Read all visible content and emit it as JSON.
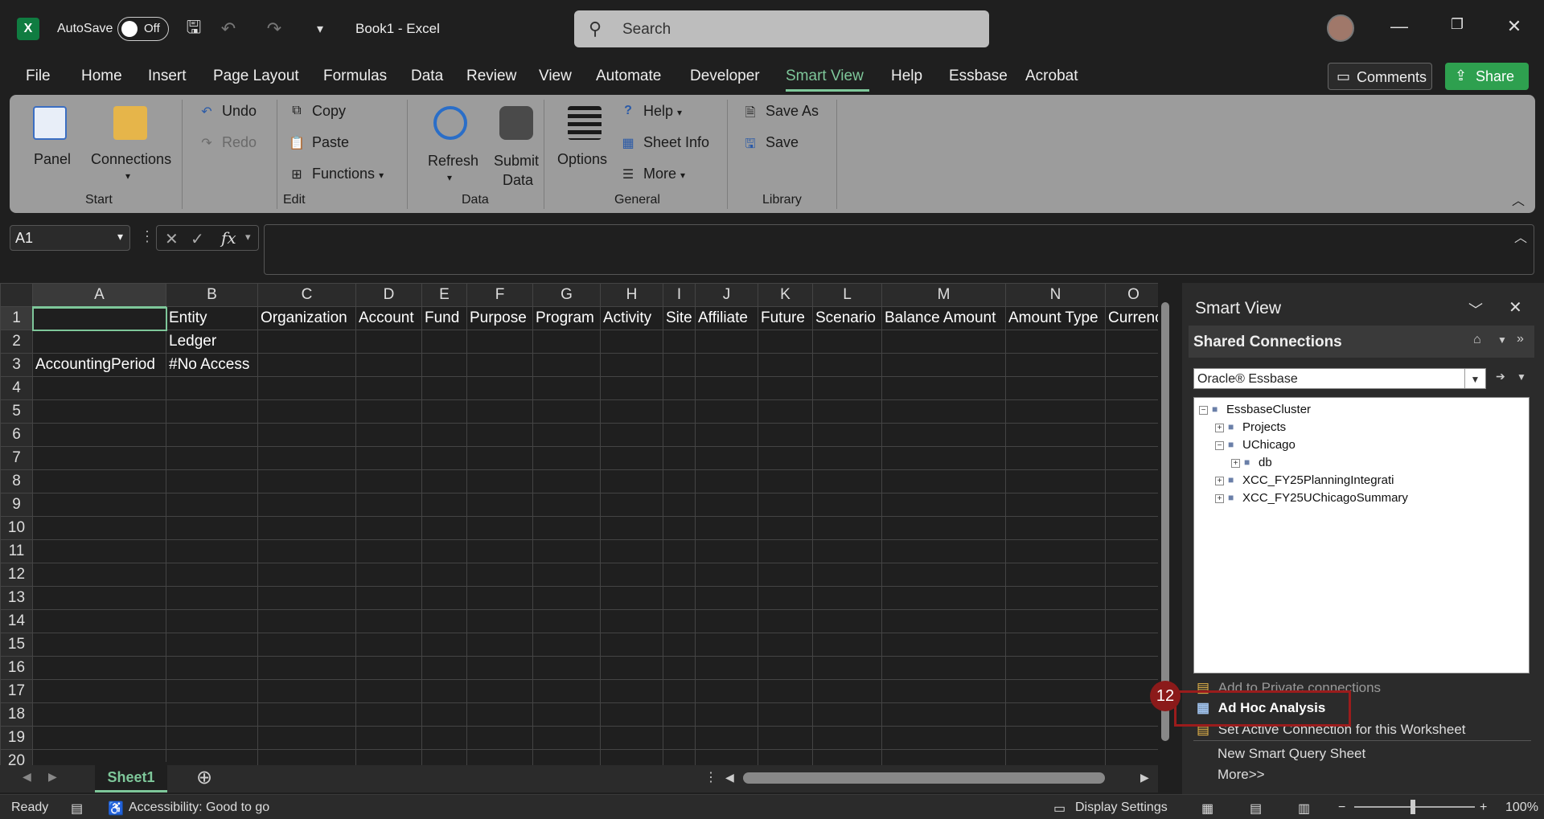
{
  "titlebar": {
    "app_logo": "X",
    "autosave_label": "AutoSave",
    "autosave_state": "Off",
    "doc_title": "Book1  -  Excel",
    "search_placeholder": "Search"
  },
  "menu": [
    "File",
    "Home",
    "Insert",
    "Page Layout",
    "Formulas",
    "Data",
    "Review",
    "View",
    "Automate",
    "Developer",
    "Smart View",
    "Help",
    "Essbase",
    "Acrobat"
  ],
  "menu_active": "Smart View",
  "comments_label": "Comments",
  "share_label": "Share",
  "ribbon": {
    "panel": "Panel",
    "connections": "Connections",
    "start_group": "Start",
    "undo": "Undo",
    "redo": "Redo",
    "copy": "Copy",
    "paste": "Paste",
    "functions": "Functions",
    "edit_group": "Edit",
    "refresh": "Refresh",
    "submit": "Submit",
    "submit2": "Data",
    "data_group": "Data",
    "options": "Options",
    "help": "Help",
    "sheet_info": "Sheet Info",
    "more": "More",
    "general_group": "General",
    "save_as": "Save As",
    "save": "Save",
    "library_group": "Library"
  },
  "formula": {
    "name_box": "A1",
    "fx": "fx"
  },
  "grid": {
    "columns": [
      "A",
      "B",
      "C",
      "D",
      "E",
      "F",
      "G",
      "H",
      "I",
      "J",
      "K",
      "L",
      "M",
      "N",
      "O"
    ],
    "rows": [
      [
        "",
        "Entity",
        "Organization",
        "Account",
        "Fund",
        "Purpose",
        "Program",
        "Activity",
        "Site",
        "Affiliate",
        "Future",
        "Scenario",
        "Balance Amount",
        "Amount Type",
        "Currenc"
      ],
      [
        "",
        "Ledger",
        "",
        "",
        "",
        "",
        "",
        "",
        "",
        "",
        "",
        "",
        "",
        "",
        ""
      ],
      [
        "AccountingPeriod",
        "#No Access",
        "",
        "",
        "",
        "",
        "",
        "",
        "",
        "",
        "",
        "",
        "",
        "",
        ""
      ],
      [
        "",
        "",
        "",
        "",
        "",
        "",
        "",
        "",
        "",
        "",
        "",
        "",
        "",
        "",
        ""
      ],
      [
        "",
        "",
        "",
        "",
        "",
        "",
        "",
        "",
        "",
        "",
        "",
        "",
        "",
        "",
        ""
      ],
      [
        "",
        "",
        "",
        "",
        "",
        "",
        "",
        "",
        "",
        "",
        "",
        "",
        "",
        "",
        ""
      ],
      [
        "",
        "",
        "",
        "",
        "",
        "",
        "",
        "",
        "",
        "",
        "",
        "",
        "",
        "",
        ""
      ],
      [
        "",
        "",
        "",
        "",
        "",
        "",
        "",
        "",
        "",
        "",
        "",
        "",
        "",
        "",
        ""
      ],
      [
        "",
        "",
        "",
        "",
        "",
        "",
        "",
        "",
        "",
        "",
        "",
        "",
        "",
        "",
        ""
      ],
      [
        "",
        "",
        "",
        "",
        "",
        "",
        "",
        "",
        "",
        "",
        "",
        "",
        "",
        "",
        ""
      ],
      [
        "",
        "",
        "",
        "",
        "",
        "",
        "",
        "",
        "",
        "",
        "",
        "",
        "",
        "",
        ""
      ],
      [
        "",
        "",
        "",
        "",
        "",
        "",
        "",
        "",
        "",
        "",
        "",
        "",
        "",
        "",
        ""
      ],
      [
        "",
        "",
        "",
        "",
        "",
        "",
        "",
        "",
        "",
        "",
        "",
        "",
        "",
        "",
        ""
      ],
      [
        "",
        "",
        "",
        "",
        "",
        "",
        "",
        "",
        "",
        "",
        "",
        "",
        "",
        "",
        ""
      ],
      [
        "",
        "",
        "",
        "",
        "",
        "",
        "",
        "",
        "",
        "",
        "",
        "",
        "",
        "",
        ""
      ],
      [
        "",
        "",
        "",
        "",
        "",
        "",
        "",
        "",
        "",
        "",
        "",
        "",
        "",
        "",
        ""
      ],
      [
        "",
        "",
        "",
        "",
        "",
        "",
        "",
        "",
        "",
        "",
        "",
        "",
        "",
        "",
        ""
      ],
      [
        "",
        "",
        "",
        "",
        "",
        "",
        "",
        "",
        "",
        "",
        "",
        "",
        "",
        "",
        ""
      ],
      [
        "",
        "",
        "",
        "",
        "",
        "",
        "",
        "",
        "",
        "",
        "",
        "",
        "",
        "",
        ""
      ],
      [
        "",
        "",
        "",
        "",
        "",
        "",
        "",
        "",
        "",
        "",
        "",
        "",
        "",
        "",
        ""
      ]
    ]
  },
  "sheet_tab": "Sheet1",
  "status": {
    "ready": "Ready",
    "accessibility": "Accessibility: Good to go",
    "display_settings": "Display Settings",
    "zoom": "100%"
  },
  "smart_view": {
    "title": "Smart View",
    "section": "Shared Connections",
    "provider": "Oracle® Essbase",
    "tree": [
      {
        "label": "EssbaseCluster",
        "level": 0,
        "exp": "−"
      },
      {
        "label": "Projects",
        "level": 1,
        "exp": "+"
      },
      {
        "label": "UChicago",
        "level": 1,
        "exp": "−"
      },
      {
        "label": "db",
        "level": 2,
        "exp": "+"
      },
      {
        "label": "XCC_FY25PlanningIntegrati",
        "level": 1,
        "exp": "+"
      },
      {
        "label": "XCC_FY25UChicagoSummary",
        "level": 1,
        "exp": "+"
      }
    ],
    "actions": {
      "add_private": "Add to Private connections",
      "ad_hoc": "Ad Hoc Analysis",
      "set_active": "Set Active Connection for this Worksheet",
      "new_smart_query": "New Smart Query Sheet",
      "more": "More>>"
    },
    "step_badge": "12"
  }
}
